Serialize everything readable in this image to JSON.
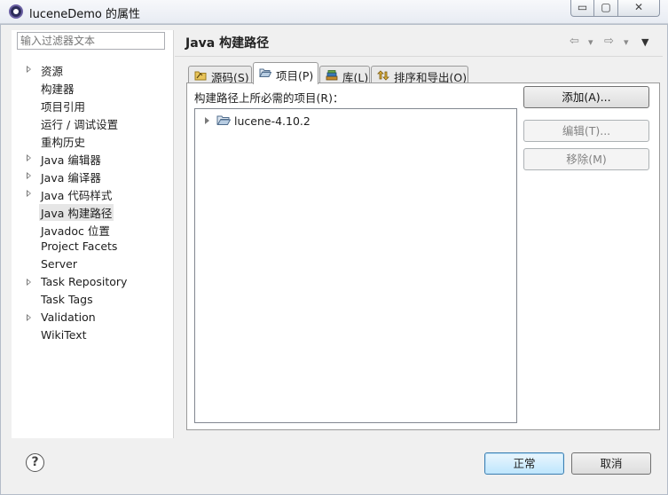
{
  "window": {
    "title": "luceneDemo 的属性",
    "min_glyph": "▭",
    "max_glyph": "▢",
    "close_glyph": "✕"
  },
  "sidebar": {
    "filter_placeholder": "输入过滤器文本",
    "items": [
      {
        "label": "资源",
        "expandable": true
      },
      {
        "label": "构建器",
        "expandable": false
      },
      {
        "label": "项目引用",
        "expandable": false
      },
      {
        "label": "运行 / 调试设置",
        "expandable": false
      },
      {
        "label": "重构历史",
        "expandable": false
      },
      {
        "label": "Java 编辑器",
        "expandable": true
      },
      {
        "label": "Java 编译器",
        "expandable": true
      },
      {
        "label": "Java 代码样式",
        "expandable": true
      },
      {
        "label": "Java 构建路径",
        "expandable": false,
        "selected": true
      },
      {
        "label": "Javadoc 位置",
        "expandable": false
      },
      {
        "label": "Project Facets",
        "expandable": false
      },
      {
        "label": "Server",
        "expandable": false
      },
      {
        "label": "Task Repository",
        "expandable": true
      },
      {
        "label": "Task Tags",
        "expandable": false
      },
      {
        "label": "Validation",
        "expandable": true
      },
      {
        "label": "WikiText",
        "expandable": false
      }
    ]
  },
  "main": {
    "title": "Java 构建路径",
    "nav": {
      "back": "⇦",
      "forward": "⇨",
      "dropdown": "▾",
      "menu": "▼"
    },
    "tabs": [
      {
        "label": "源码(S)",
        "icon": "source-folder-icon"
      },
      {
        "label": "项目(P)",
        "icon": "project-folder-icon",
        "active": true
      },
      {
        "label": "库(L)",
        "icon": "library-icon"
      },
      {
        "label": "排序和导出(O)",
        "icon": "order-export-icon"
      }
    ],
    "section_label": "构建路径上所必需的项目(R)：",
    "projects": [
      {
        "label": "lucene-4.10.2"
      }
    ],
    "buttons": {
      "add": "添加(A)...",
      "edit": "编辑(T)...",
      "remove": "移除(M)"
    }
  },
  "footer": {
    "help": "?",
    "ok": "正常",
    "cancel": "取消"
  },
  "colors": {
    "selected_bg": "#e6e6e6",
    "default_button": "#bee6fd"
  }
}
